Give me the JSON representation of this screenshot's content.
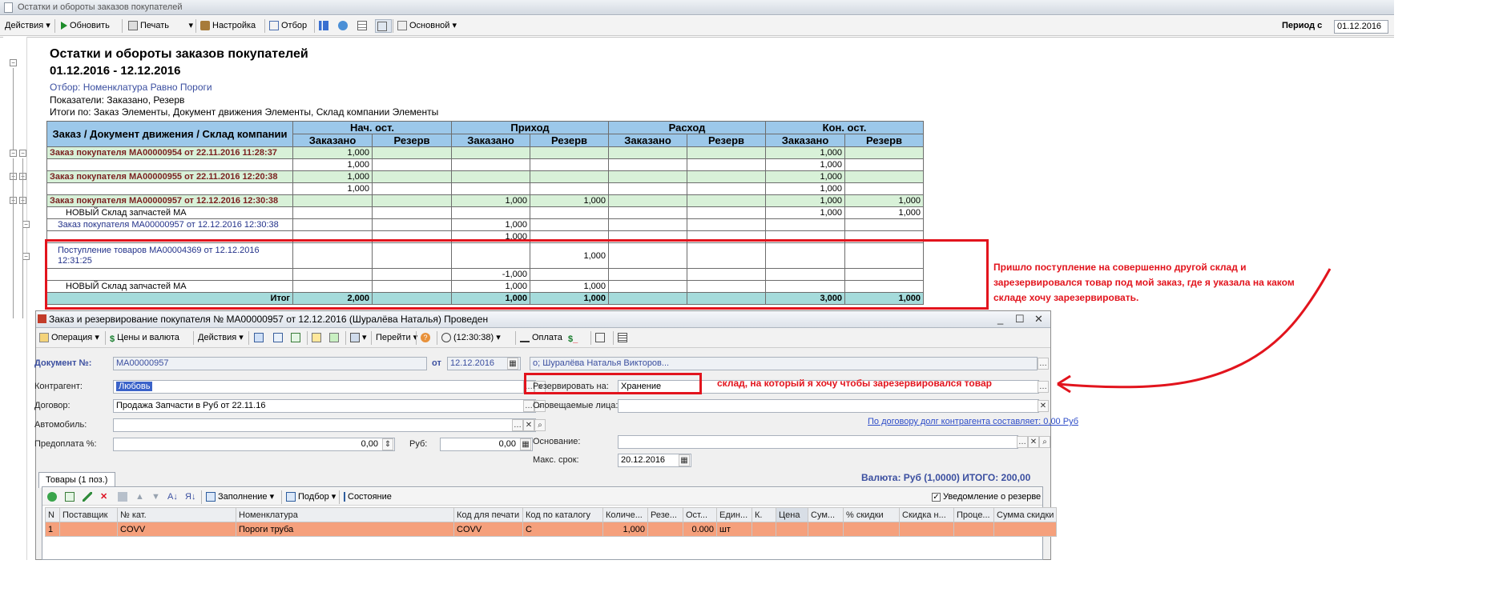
{
  "report": {
    "window_title": "Остатки и обороты заказов покупателей",
    "toolbar": {
      "actions": "Действия",
      "refresh": "Обновить",
      "print": "Печать",
      "settings": "Настройка",
      "filter": "Отбор",
      "variant": "Основной",
      "period_label": "Период с",
      "period_value": "01.12.2016"
    },
    "heading": "Остатки и обороты заказов покупателей",
    "period": "01.12.2016 - 12.12.2016",
    "filter_text": "Отбор: Номенклатура Равно Пороги",
    "indicators": "Показатели: Заказано, Резерв",
    "totals_by": "Итоги по: Заказ Элементы, Документ движения Элементы, Склад компании Элементы",
    "columns": {
      "first": "Заказ / Документ движения / Склад компании",
      "groups": [
        "Нач. ост.",
        "Приход",
        "Расход",
        "Кон. ост."
      ],
      "sub": [
        "Заказано",
        "Резерв",
        "Заказано",
        "Резерв",
        "Заказано",
        "Резерв",
        "Заказано",
        "Резерв"
      ]
    },
    "rows": [
      {
        "type": "grp",
        "indent": 0,
        "name": "Заказ покупателя МА00000954 от 22.11.2016 11:28:37",
        "cells": [
          "1,000",
          "",
          "",
          "",
          "",
          "",
          "1,000",
          ""
        ]
      },
      {
        "type": "sub",
        "indent": 2,
        "name": "",
        "cells": [
          "1,000",
          "",
          "",
          "",
          "",
          "",
          "1,000",
          ""
        ]
      },
      {
        "type": "grp",
        "indent": 0,
        "name": "Заказ покупателя МА00000955 от 22.11.2016 12:20:38",
        "cells": [
          "1,000",
          "",
          "",
          "",
          "",
          "",
          "1,000",
          ""
        ]
      },
      {
        "type": "sub",
        "indent": 2,
        "name": "",
        "cells": [
          "1,000",
          "",
          "",
          "",
          "",
          "",
          "1,000",
          ""
        ]
      },
      {
        "type": "grp",
        "indent": 0,
        "name": "Заказ покупателя МА00000957 от 12.12.2016 12:30:38",
        "cells": [
          "",
          "",
          "1,000",
          "1,000",
          "",
          "",
          "1,000",
          "1,000"
        ]
      },
      {
        "type": "sub",
        "indent": 2,
        "name": "НОВЫЙ Склад запчастей МА",
        "cells": [
          "",
          "",
          "",
          "",
          "",
          "",
          "1,000",
          "1,000"
        ]
      },
      {
        "type": "doc",
        "indent": 1,
        "name": "Заказ покупателя МА00000957 от 12.12.2016 12:30:38",
        "cells": [
          "",
          "",
          "1,000",
          "",
          "",
          "",
          "",
          ""
        ]
      },
      {
        "type": "sub",
        "indent": 2,
        "name": "",
        "cells": [
          "",
          "",
          "1,000",
          "",
          "",
          "",
          "",
          ""
        ]
      },
      {
        "type": "doc2",
        "indent": 1,
        "name": "Поступление товаров МА00004369 от 12.12.2016 12:31:25",
        "cells": [
          "",
          "",
          "",
          "1,000",
          "",
          "",
          "",
          ""
        ]
      },
      {
        "type": "sub",
        "indent": 2,
        "name": "",
        "cells": [
          "",
          "",
          "-1,000",
          "",
          "",
          "",
          "",
          ""
        ]
      },
      {
        "type": "sub",
        "indent": 2,
        "name": "НОВЫЙ Склад запчастей МА",
        "cells": [
          "",
          "",
          "1,000",
          "1,000",
          "",
          "",
          "",
          ""
        ]
      }
    ],
    "total": {
      "name": "Итог",
      "cells": [
        "2,000",
        "",
        "1,000",
        "1,000",
        "",
        "",
        "3,000",
        "1,000"
      ]
    },
    "note": "Пришло поступление на совершенно другой склад и зарезервировался товар под мой заказ, где я указала на каком складе хочу зарезервировать."
  },
  "document": {
    "title": "Заказ и резервирование покупателя № МА00000957 от 12.12.2016 (Шуралёва Наталья) Проведен",
    "toolbar": {
      "operation": "Операция",
      "prices": "Цены и валюта",
      "actions": "Действия",
      "goto": "Перейти",
      "time": "(12:30:38)",
      "payment": "Оплата"
    },
    "doc_no_label": "Документ №:",
    "doc_no": "МА00000957",
    "date_label": "от",
    "date": "12.12.2016",
    "responsible": "о; Шуралёва Наталья Викторов...",
    "contractor_label": "Контрагент:",
    "contractor": "Любовь",
    "contract_label": "Договор:",
    "contract": "Продажа Запчасти в Руб от 22.11.16",
    "car_label": "Автомобиль:",
    "car": "",
    "prepay_label": "Предоплата %:",
    "prepay": "0,00",
    "rub_label": "Руб:",
    "rub": "0,00",
    "reserve_label": "Резервировать на:",
    "reserve_value": "Хранение",
    "reserve_note": "склад, на который я хочу чтобы зарезервировался товар",
    "notify_label": "Оповещаемые лица:",
    "debt_link": "По договору долг контрагента составляет: 0,00 Руб",
    "basis_label": "Основание:",
    "max_term_label": "Макс. срок:",
    "max_term": "20.12.2016",
    "currency_total": "Валюта: Руб (1,0000) ИТОГО: 200,00",
    "tab_goods": "Товары (1 поз.)",
    "grid_toolbar": {
      "fill": "Заполнение",
      "select": "Подбор",
      "state": "Состояние",
      "reserve_notice": "Уведомление о резерве"
    },
    "grid_headers": [
      "N",
      "Поставщик",
      "№ кат.",
      "Номенклатура",
      "Код для печати",
      "Код по каталогу",
      "Количе...",
      "Резе...",
      "Ост...",
      "Един...",
      "К.",
      "Цена",
      "Сум...",
      "% скидки",
      "Скидка н...",
      "Проце...",
      "Сумма скидки"
    ],
    "grid_row": [
      "1",
      "",
      "COVV",
      "Пороги труба",
      "COVV",
      "С",
      "1,000",
      "",
      "0.000",
      "шт",
      "",
      "",
      "",
      "",
      "",
      "",
      ""
    ]
  },
  "colors": {
    "accent_red": "#e2141d",
    "header_blue": "#9cc8ea",
    "group_green": "#d8f1d8",
    "total_cyan": "#a5dbdb",
    "row_orange": "#f5a07c"
  }
}
